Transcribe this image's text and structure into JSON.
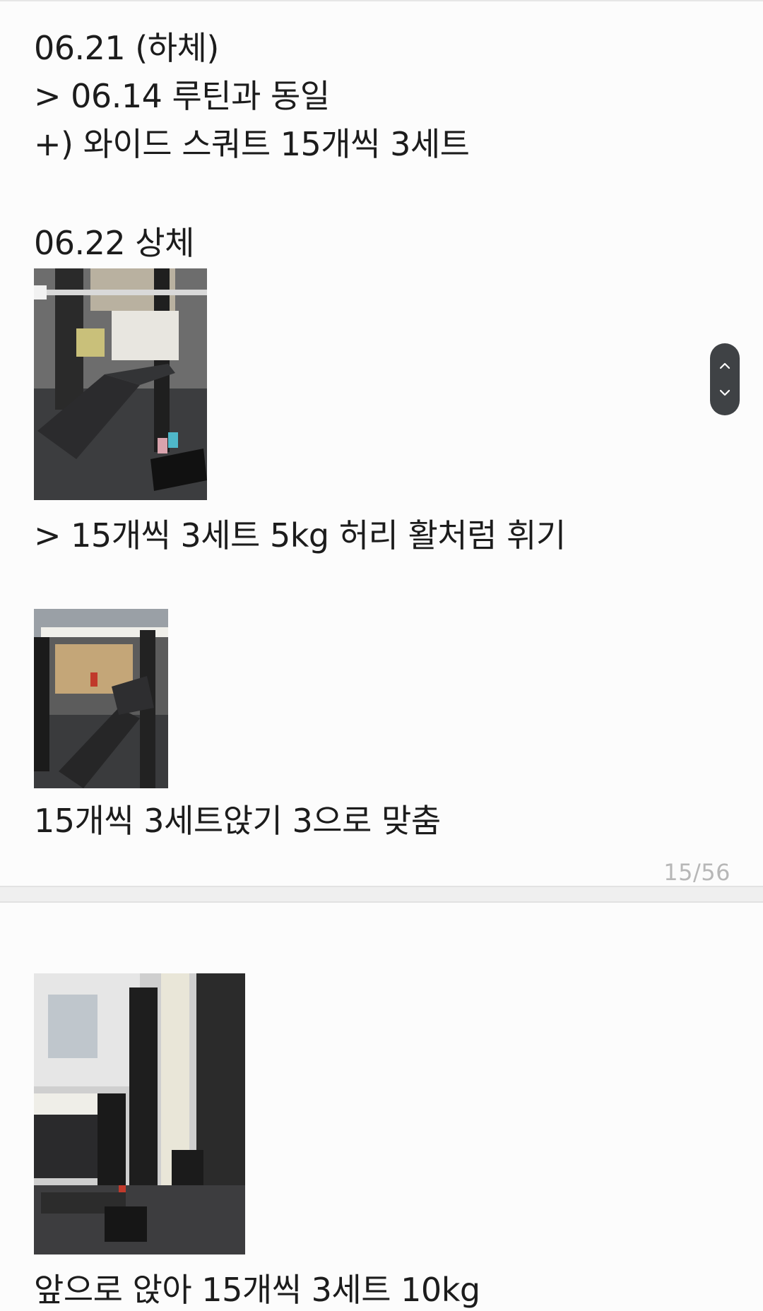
{
  "page1": {
    "lines": [
      "06.21 (하체)",
      "> 06.14 루틴과 동일",
      "+) 와이드 스쿼트 15개씩 3세트",
      "06.22 상체",
      "> 15개씩 3세트 5kg 허리 활처럼 휘기",
      "15개씩 3세트앉기 3으로 맞춤"
    ],
    "page_indicator": "15/56"
  },
  "page2": {
    "lines": [
      "앞으로 앉아 15개씩 3세트 10kg"
    ]
  },
  "scroll_control": {
    "up_icon": "chevron-up-icon",
    "down_icon": "chevron-down-icon"
  },
  "colors": {
    "background": "#fcfcfc",
    "text": "#1c1c1c",
    "indicator": "#b7b7b7",
    "scroll_control": "#3f4245"
  }
}
